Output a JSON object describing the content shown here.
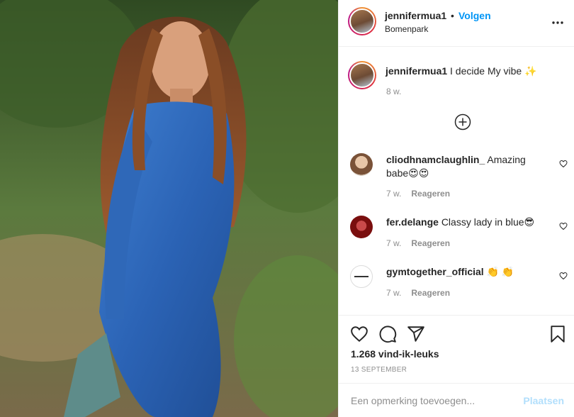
{
  "post": {
    "username": "jennifermua1",
    "separator": "•",
    "follow_label": "Volgen",
    "location": "Bomenpark",
    "caption_text": "I decide My vibe",
    "caption_emoji": "✨",
    "caption_time": "8 w."
  },
  "comments": [
    {
      "username": "cliodhnamclaughlin_",
      "text": "Amazing babe😍😍",
      "time": "7 w.",
      "reply_label": "Reageren",
      "avatar_color": "#c9a78a"
    },
    {
      "username": "fer.delange",
      "text": "Classy lady in blue😎",
      "time": "7 w.",
      "reply_label": "Reageren",
      "avatar_color": "#8b1a1a"
    },
    {
      "username": "gymtogether_official",
      "text": "👏 👏",
      "time": "7 w.",
      "reply_label": "Reageren",
      "avatar_color": "#ffffff"
    }
  ],
  "likes": "1.268 vind-ik-leuks",
  "date": "13 SEPTEMBER",
  "comment_box": {
    "placeholder": "Een opmerking toevoegen...",
    "post_label": "Plaatsen"
  },
  "colors": {
    "accent": "#0095f6",
    "post_disabled": "#b2dffc",
    "muted": "#8e8e8e"
  },
  "icons": {
    "more": "more-horizontal-icon",
    "add": "plus-circle-icon",
    "like": "heart-icon",
    "comment": "comment-icon",
    "share": "paper-plane-icon",
    "save": "bookmark-icon"
  }
}
